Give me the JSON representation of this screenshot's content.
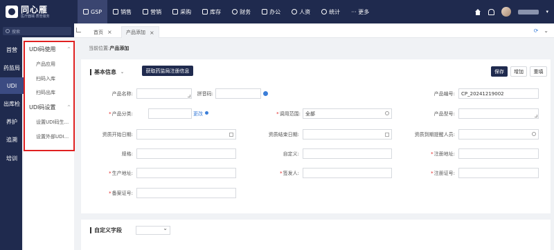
{
  "app": {
    "logo_title": "同心雁",
    "logo_subtitle": "医疗器械·质管服务"
  },
  "topnav": [
    {
      "label": "GSP",
      "active": true
    },
    {
      "label": "销售"
    },
    {
      "label": "营销"
    },
    {
      "label": "采购"
    },
    {
      "label": "库存"
    },
    {
      "label": "财务"
    },
    {
      "label": "办公"
    },
    {
      "label": "人资"
    },
    {
      "label": "统计"
    },
    {
      "label": "··· 更多"
    }
  ],
  "sidebar": {
    "search_placeholder": "搜索",
    "items": [
      {
        "label": "首营"
      },
      {
        "label": "药监局"
      },
      {
        "label": "UDI",
        "active": true
      },
      {
        "label": "出库检"
      },
      {
        "label": "养护"
      },
      {
        "label": "追溯"
      },
      {
        "label": "培训"
      }
    ]
  },
  "submenu": {
    "groups": [
      {
        "label": "UDI码使用",
        "items": [
          "产品应用",
          "扫码入库",
          "扫码出库"
        ]
      },
      {
        "label": "UDI码设置",
        "items": [
          "设置UDI码生...",
          "设置外部UDI..."
        ]
      }
    ]
  },
  "tabs": {
    "items": [
      {
        "label": "首页"
      },
      {
        "label": "产品添加",
        "active": true
      }
    ]
  },
  "breadcrumb": {
    "prefix": "当前位置:",
    "current": "产品添加"
  },
  "section_basic": {
    "title": "基本信息",
    "fetch_button": "获取药监局注册信息",
    "save_button": "保存",
    "add_button": "增加",
    "reset_button": "重填"
  },
  "form": {
    "product_name_label": "产品名称:",
    "pinyin_label": "拼音码:",
    "product_code_label": "产品编号:",
    "product_code_value": "CP_20241219002",
    "category_label": "产品分类:",
    "change_label": "更改",
    "scope_label": "调用范围:",
    "scope_value": "全部",
    "model_label": "产品型号:",
    "qual_start_label": "资质开始日期:",
    "qual_end_label": "资质结束日期:",
    "qual_reminder_label": "资质到期提醒人员:",
    "spec_label": "规格:",
    "custom_label": "自定义:",
    "reg_address_label": "注册地址:",
    "prod_address_label": "生产地址:",
    "issuer_label": "签发人:",
    "reg_cert_label": "注册证号:",
    "record_cert_label": "备案证号:"
  },
  "section_custom": {
    "title": "自定义字段"
  }
}
